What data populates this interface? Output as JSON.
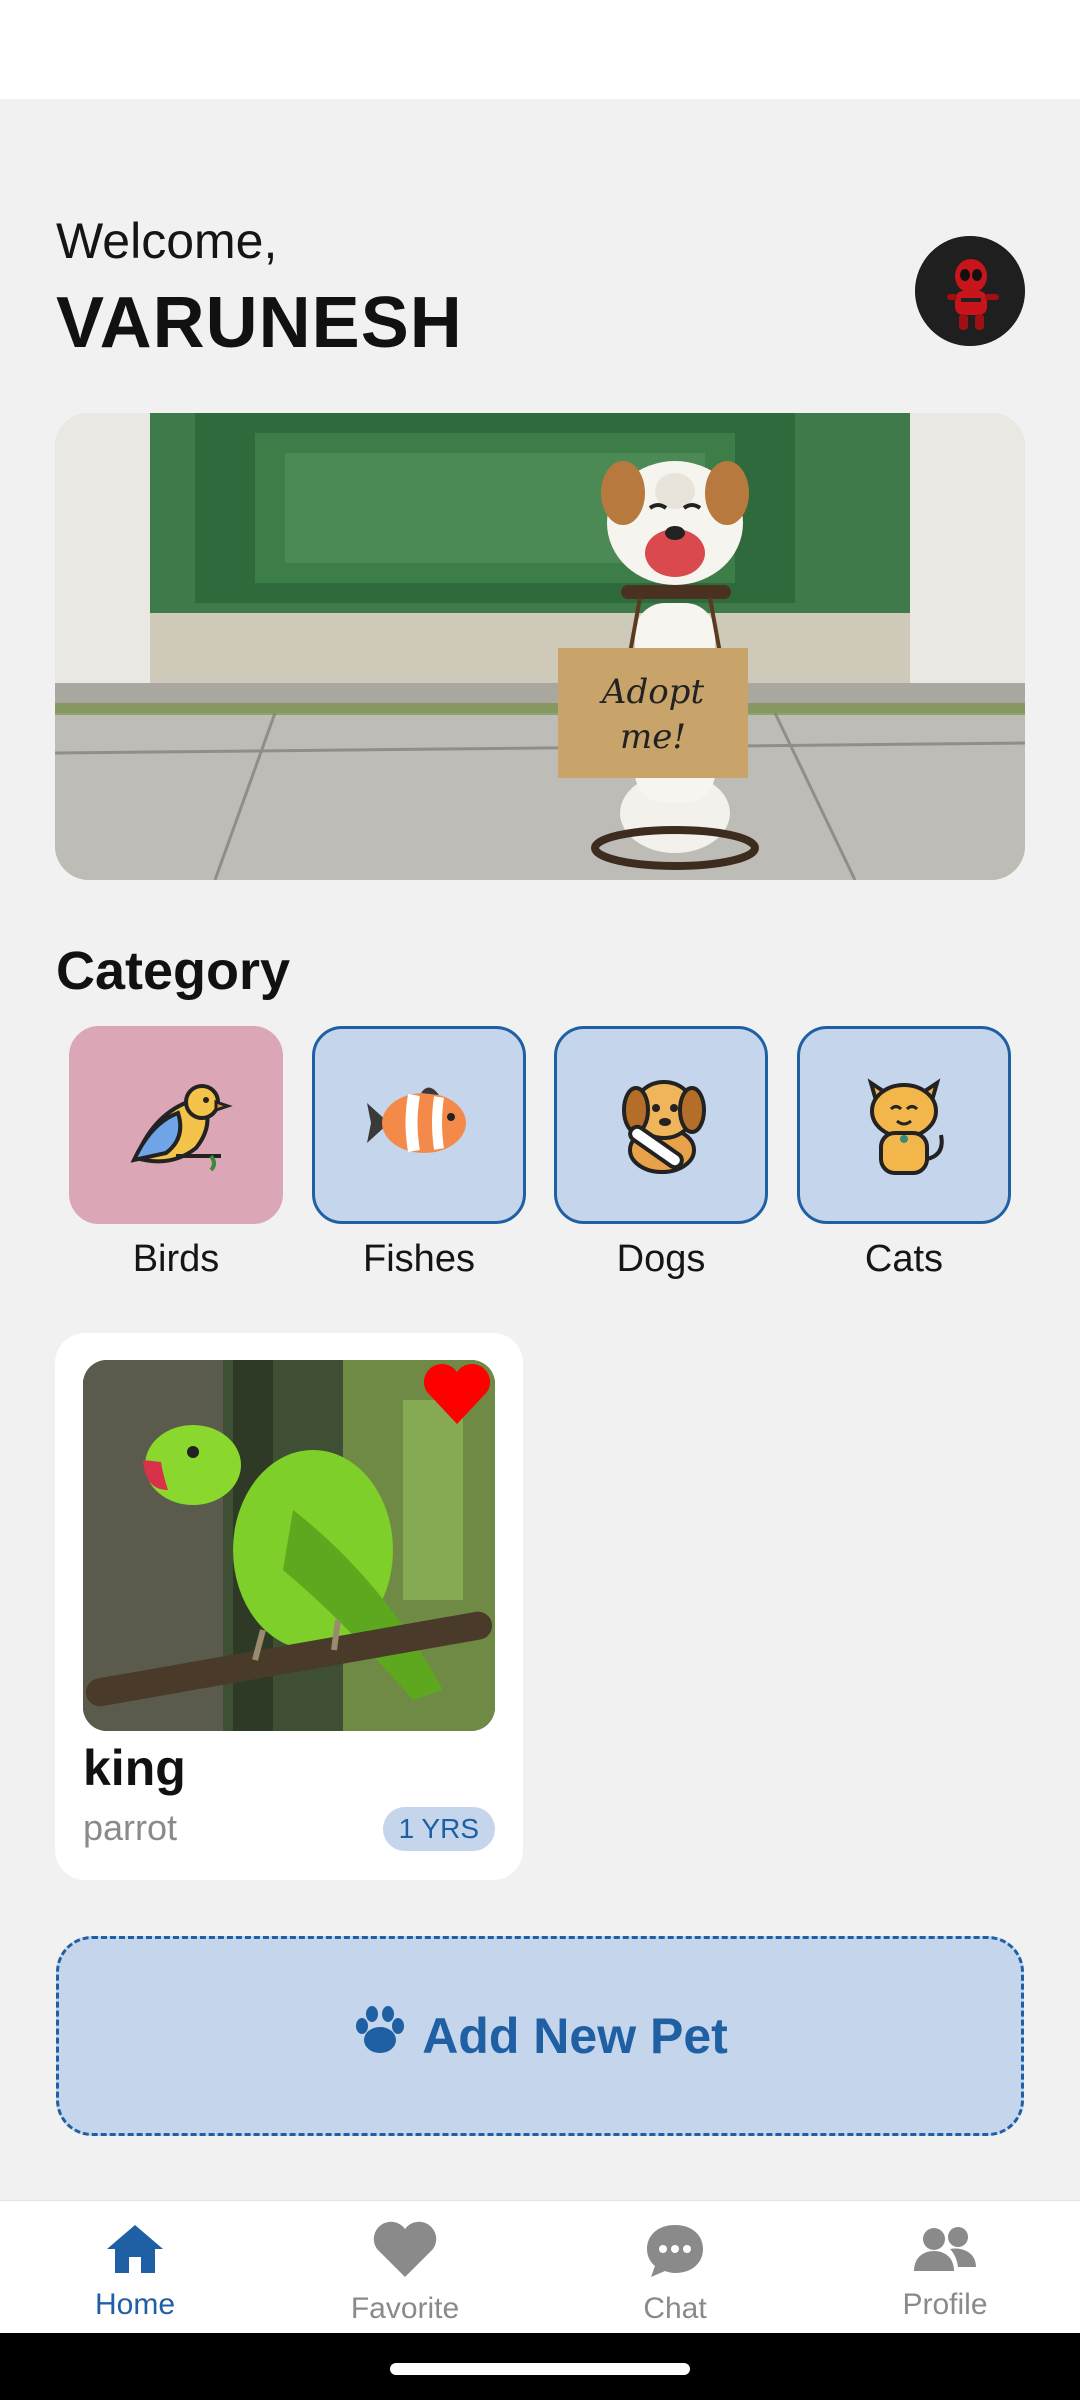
{
  "header": {
    "welcome": "Welcome,",
    "username": "VARUNESH"
  },
  "category": {
    "title": "Category",
    "items": [
      {
        "label": "Birds",
        "icon": "bird-icon",
        "selected": true
      },
      {
        "label": "Fishes",
        "icon": "fish-icon",
        "selected": false
      },
      {
        "label": "Dogs",
        "icon": "dog-icon",
        "selected": false
      },
      {
        "label": "Cats",
        "icon": "cat-icon",
        "selected": false
      }
    ]
  },
  "pets": [
    {
      "name": "king",
      "type": "parrot",
      "age": "1 YRS",
      "favorite": true
    }
  ],
  "add_pet": {
    "label": "Add New Pet",
    "icon": "paw-icon"
  },
  "nav": {
    "items": [
      {
        "label": "Home",
        "icon": "home-icon",
        "active": true
      },
      {
        "label": "Favorite",
        "icon": "heart-icon",
        "active": false
      },
      {
        "label": "Chat",
        "icon": "chat-icon",
        "active": false
      },
      {
        "label": "Profile",
        "icon": "profile-icon",
        "active": false
      }
    ]
  },
  "colors": {
    "accent": "#1f5fa3",
    "accent_light": "#c5d5eb",
    "selected_category": "#dba7b7",
    "background": "#f1f1f1",
    "favorite": "#ff0000"
  }
}
